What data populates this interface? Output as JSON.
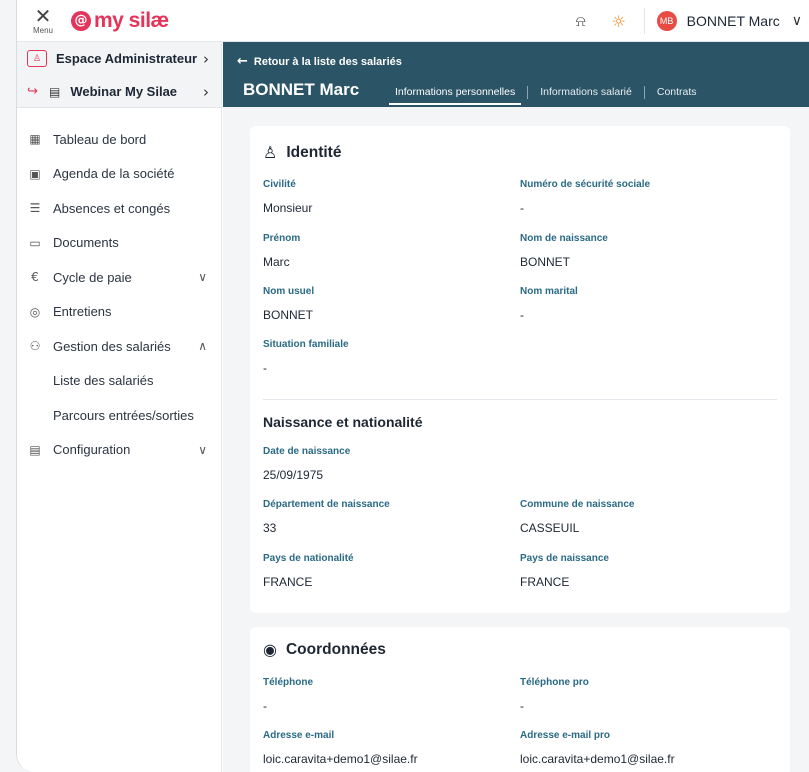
{
  "topbar": {
    "menu_label": "Menu",
    "logo_mark": "@",
    "logo_text": "my silæ",
    "user_initials": "MB",
    "user_name": "BONNET Marc"
  },
  "sidebar": {
    "admin_label": "Espace Administrateur",
    "company_label": "Webinar My Silae",
    "nav": [
      {
        "label": "Tableau de bord",
        "icon": "dashboard-icon"
      },
      {
        "label": "Agenda de la société",
        "icon": "calendar-icon"
      },
      {
        "label": "Absences et congés",
        "icon": "list-icon"
      },
      {
        "label": "Documents",
        "icon": "folder-icon"
      },
      {
        "label": "Cycle de paie",
        "icon": "payroll-icon"
      },
      {
        "label": "Entretiens",
        "icon": "interview-icon"
      },
      {
        "label": "Gestion des salariés",
        "icon": "employees-icon"
      },
      {
        "label": "Liste des salariés"
      },
      {
        "label": "Parcours entrées/sorties"
      },
      {
        "label": "Configuration",
        "icon": "configuration-icon"
      }
    ]
  },
  "header": {
    "back_label": "Retour à la liste des salariés",
    "employee_name": "BONNET Marc",
    "tabs": [
      {
        "label": "Informations personnelles",
        "active": true
      },
      {
        "label": "Informations salarié",
        "active": false
      },
      {
        "label": "Contrats",
        "active": false
      }
    ]
  },
  "identite": {
    "title": "Identité",
    "fields": [
      {
        "label": "Civilité",
        "value": "Monsieur"
      },
      {
        "label": "Numéro de sécurité sociale",
        "value": "-"
      },
      {
        "label": "Prénom",
        "value": "Marc"
      },
      {
        "label": "Nom de naissance",
        "value": "BONNET"
      },
      {
        "label": "Nom usuel",
        "value": "BONNET"
      },
      {
        "label": "Nom marital",
        "value": "-"
      },
      {
        "label": "Situation familiale",
        "value": "-"
      }
    ]
  },
  "naissance": {
    "title": "Naissance et nationalité",
    "fields": [
      {
        "label": "Date de naissance",
        "value": "25/09/1975"
      },
      {
        "label": "Département de naissance",
        "value": "33"
      },
      {
        "label": "Commune de naissance",
        "value": "CASSEUIL"
      },
      {
        "label": "Pays de nationalité",
        "value": "FRANCE"
      },
      {
        "label": "Pays de naissance",
        "value": "FRANCE"
      }
    ]
  },
  "coordonnees": {
    "title": "Coordonnées",
    "fields": [
      {
        "label": "Téléphone",
        "value": "-"
      },
      {
        "label": "Téléphone pro",
        "value": "-"
      },
      {
        "label": "Adresse e-mail",
        "value": "loic.caravita+demo1@silae.fr"
      },
      {
        "label": "Adresse e-mail pro",
        "value": "loic.caravita+demo1@silae.fr"
      }
    ]
  },
  "colors": {
    "brand": "#e4345a",
    "header_bg": "#2b5466",
    "field_label": "#2a6a85"
  }
}
